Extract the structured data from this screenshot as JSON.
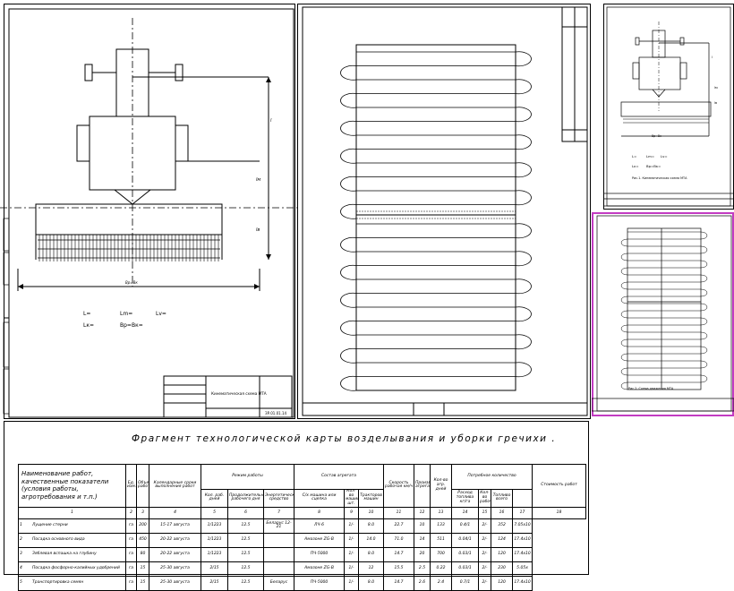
{
  "drawing_left": {
    "dim_top": "l",
    "dim_mid": "lм",
    "dim_lower": "lв",
    "width_label": "Вр=Вк",
    "params_row1": [
      "L=",
      "Lm=",
      "Lv="
    ],
    "params_row2": [
      "Lк=",
      "Вр=Вк="
    ],
    "stamp_title": "Кинематическая схема МТА",
    "stamp_code": "ЗР.01.01.14"
  },
  "drawing_right_top": {
    "dim_top": "l",
    "dim_mid": "lм",
    "dim_lower": "lв",
    "width_label": "Вр=Вк",
    "params_row1": [
      "L=",
      "Lm=",
      "Lv="
    ],
    "params_row2": [
      "Lк=",
      "Вр=Вк="
    ],
    "caption": "Рис.1. Кинематическая схема МТА"
  },
  "drawing_right_bottom": {
    "caption": "Рис.2. Схема движения МТА"
  },
  "table": {
    "title": "Фрагмент технологической карты возделывания и уборки гречихи .",
    "header": {
      "name_col": "Наименование работ, качественные показатели (условия работы, агротребования и т.п.)",
      "unit": "Ед. изм.",
      "volume": "Объем работ",
      "calendar": "Календарные сроки выполнения работ",
      "mode_group": "Режим работы",
      "mode_shift": "Кол. раб. дней",
      "mode_duration": "Продолжительность рабочего дня",
      "unit_group": "Состав агрегата",
      "energy": "Энергетическое средство",
      "machine": "С/х машина или сцепка",
      "count": "Кол-во машин шт.",
      "speed": "Скорость рабочая км/ч",
      "productivity": "Производительность агрегата",
      "days": "Кол-во агр. дней",
      "needs_group": "Потребное количество",
      "tractors": "Тракторов машин",
      "fuel": "Расход топлива кг/га",
      "workers": "Кол-во рабочих",
      "fuel_total": "Топливо всего",
      "notes": "Стоимость работ"
    },
    "column_numbers": [
      "1",
      "2",
      "3",
      "4",
      "5",
      "6",
      "7",
      "8",
      "9",
      "10",
      "11",
      "12",
      "13",
      "14",
      "15",
      "16",
      "17",
      "18"
    ],
    "rows": [
      {
        "no": "1",
        "name": "Лущение стерни",
        "unit": "га",
        "volume": "200",
        "dates": "15-17 августа",
        "shift": "1/1223",
        "hours": "12.5",
        "energy": "Беларус 12-21",
        "machine": "ЛЧ-6",
        "count": "1/-",
        "speed": "8.0",
        "prod": "22.7",
        "days": "10",
        "tractors": "133",
        "fuel": "0.4/1",
        "workers": "2/-",
        "fuel_total": "352",
        "notes": "7.05х10"
      },
      {
        "no": "2",
        "name": "Посадка основного вида",
        "unit": "га",
        "volume": "450",
        "dates": "20-22 августа",
        "shift": "1/1223",
        "hours": "12.5",
        "energy": "",
        "machine": "Амазоне ZG-B",
        "count": "1/-",
        "speed": "14.0",
        "prod": "71.0",
        "days": "14",
        "tractors": "511",
        "fuel": "0.04/1",
        "workers": "2/-",
        "fuel_total": "124",
        "notes": "17.4х10"
      },
      {
        "no": "3",
        "name": "Зяблевая вспашка на глубину",
        "unit": "га",
        "volume": "80",
        "dates": "20-22 августа",
        "shift": "1/1223",
        "hours": "12.5",
        "energy": "",
        "machine": "ПЧ-5000",
        "count": "1/-",
        "speed": "8.0",
        "prod": "14.7",
        "days": "20",
        "tractors": "700",
        "fuel": "0.03/1",
        "workers": "2/-",
        "fuel_total": "120",
        "notes": "17.4х10"
      },
      {
        "no": "4",
        "name": "Посадка фосфорно-калийных удобрений",
        "unit": "га",
        "volume": "15",
        "dates": "25-30 августа",
        "shift": "2/15",
        "hours": "12.5",
        "energy": "",
        "machine": "Амазоне ZG-B",
        "count": "1/-",
        "speed": "12",
        "prod": "15.5",
        "days": "2.5",
        "tractors": "0.22",
        "fuel": "0.03/1",
        "workers": "2/-",
        "fuel_total": "230",
        "notes": "5.05х"
      },
      {
        "no": "5",
        "name": "Транспортировка семян",
        "unit": "га",
        "volume": "15",
        "dates": "25-30 августа",
        "shift": "2/15",
        "hours": "12.5",
        "energy": "Беларус",
        "machine": "ПЧ-5000",
        "count": "1/-",
        "speed": "8.0",
        "prod": "14.7",
        "days": "2.6",
        "tractors": "2.4",
        "fuel": "0.7/1",
        "workers": "2/-",
        "fuel_total": "120",
        "notes": "17.4х10"
      }
    ]
  }
}
